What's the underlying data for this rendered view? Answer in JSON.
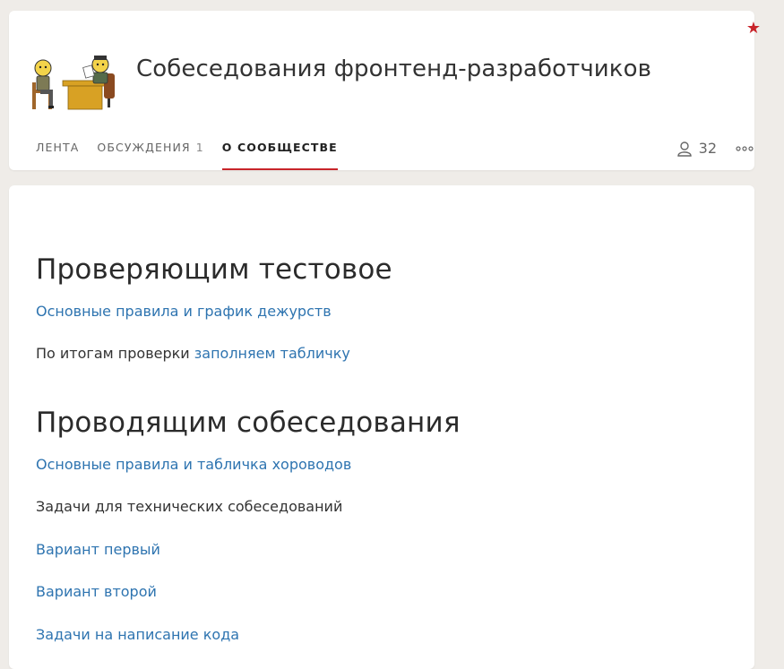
{
  "community": {
    "title": "Собеседования фронтенд-разработчиков",
    "logo_icon": "interview-comic-logo",
    "star_icon": "star-icon",
    "accent_color": "#c8242a"
  },
  "tabs": [
    {
      "label": "Лента",
      "count": ""
    },
    {
      "label": "Обсуждения",
      "count": "1"
    },
    {
      "label": "О сообществе",
      "count": "",
      "active": true
    }
  ],
  "members": {
    "count": "32",
    "icon": "user-icon"
  },
  "more_icon": "more-dots-icon",
  "content": {
    "section1": {
      "heading": "Проверяющим тестовое",
      "rules_link": "Основные правила и график дежурств",
      "results_prefix": "По итогам проверки ",
      "results_link": "заполняем табличку"
    },
    "section2": {
      "heading": "Проводящим собеседования",
      "rules_link": "Основные правила и табличка хороводов",
      "tasks_text": "Задачи для технических собеседований",
      "variant1": "Вариант первый",
      "variant2": "Вариант второй",
      "coding_tasks": "Задачи на написание кода"
    }
  },
  "colors": {
    "link": "#2e74b0",
    "text": "#333333",
    "background": "#efece8"
  }
}
